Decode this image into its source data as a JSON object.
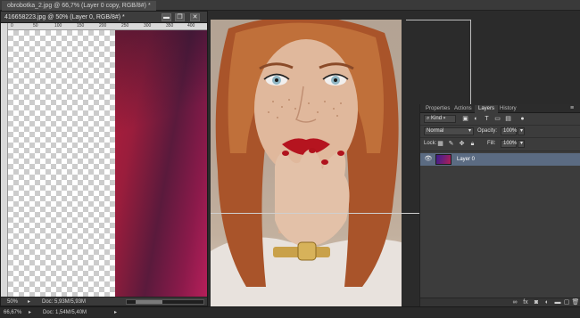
{
  "background_document": {
    "tab_title": "obrobotka_2.jpg @ 66,7% (Layer 0 copy, RGB/8#) *"
  },
  "floating_document": {
    "title": "416658223.jpg @ 50% (Layer 0, RGB/8#) *",
    "buttons": {
      "minimize": "▬",
      "restore": "❐",
      "close": "✕"
    },
    "ruler_ticks": [
      "0",
      "50",
      "100",
      "150",
      "200",
      "250",
      "300",
      "350",
      "400"
    ],
    "zoom": "50%",
    "doc_info": "Doc: 5,93M/5,93M"
  },
  "layers_panel": {
    "tabs": [
      "Properties",
      "Actions",
      "Layers",
      "History"
    ],
    "active_tab": "Layers",
    "menu_icon": "≡",
    "filter": {
      "kind_label": "Kind",
      "icons": [
        "image-filter-icon",
        "adjustment-filter-icon",
        "type-filter-icon",
        "shape-filter-icon",
        "smart-object-filter-icon"
      ]
    },
    "blend_mode": "Normal",
    "opacity_label": "Opacity:",
    "opacity_value": "100%",
    "lock_label": "Lock:",
    "fill_label": "Fill:",
    "fill_value": "100%",
    "layers": [
      {
        "name": "Layer 0",
        "visible": true,
        "selected": true
      }
    ],
    "footer_icons": [
      "link-layers-icon",
      "fx-icon",
      "add-mask-icon",
      "adjustment-layer-icon",
      "new-group-icon",
      "new-layer-icon",
      "delete-layer-icon"
    ]
  },
  "status_bar": {
    "zoom": "66,67%",
    "doc_info": "Doc: 1,54M/5,40M"
  },
  "colors": {
    "selected_layer": "#5b6b82",
    "panel_bg": "#3c3c3c",
    "app_bg": "#282828"
  }
}
